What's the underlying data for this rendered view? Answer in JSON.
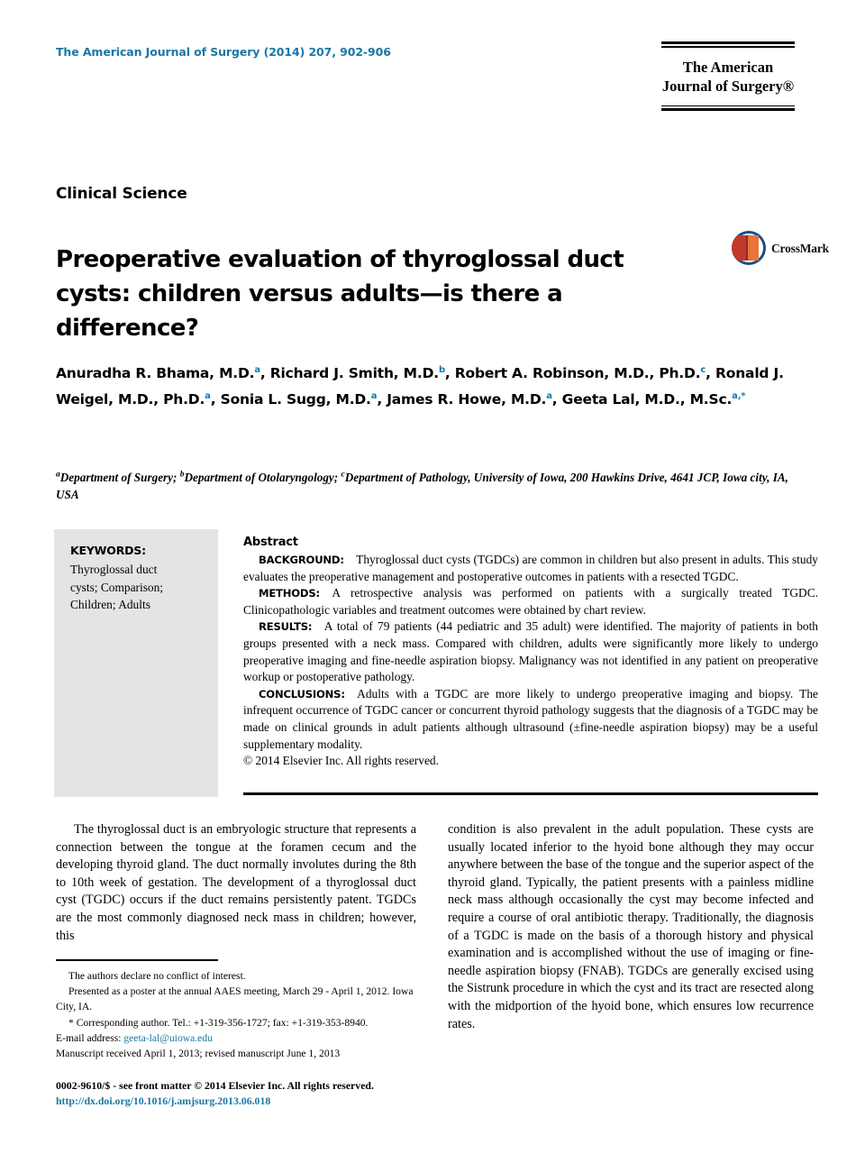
{
  "masthead": {
    "journal_reference": "The American Journal of Surgery (2014) 207, 902-906",
    "logo_line1": "The American",
    "logo_line2": "Journal of Surgery®"
  },
  "section_label": "Clinical Science",
  "title": "Preoperative evaluation of thyroglossal duct cysts: children versus adults—is there a difference?",
  "crossmark": {
    "label": "CrossMark"
  },
  "authors_html": "Anuradha R. Bhama, M.D.<sup>a</sup>, Richard J. Smith, M.D.<sup>b</sup>, Robert A. Robinson, M.D., Ph.D.<sup>c</sup>, Ronald J. Weigel, M.D., Ph.D.<sup>a</sup>, Sonia L. Sugg, M.D.<sup>a</sup>, James R. Howe, M.D.<sup>a</sup>, Geeta Lal, M.D., M.Sc.<sup>a,*</sup>",
  "affiliations_html": "<sup>a</sup>Department of Surgery; <sup>b</sup>Department of Otolaryngology; <sup>c</sup>Department of Pathology, University of Iowa, 200 Hawkins Drive, 4641 JCP, Iowa city, IA, USA",
  "keywords": {
    "heading": "KEYWORDS:",
    "list": "Thyroglossal duct cysts; Comparison; Children; Adults"
  },
  "abstract": {
    "heading": "Abstract",
    "sections": [
      {
        "label": "BACKGROUND:",
        "text": "Thyroglossal duct cysts (TGDCs) are common in children but also present in adults. This study evaluates the preoperative management and postoperative outcomes in patients with a resected TGDC."
      },
      {
        "label": "METHODS:",
        "text": "A retrospective analysis was performed on patients with a surgically treated TGDC. Clinicopathologic variables and treatment outcomes were obtained by chart review."
      },
      {
        "label": "RESULTS:",
        "text": "A total of 79 patients (44 pediatric and 35 adult) were identified. The majority of patients in both groups presented with a neck mass. Compared with children, adults were significantly more likely to undergo preoperative imaging and fine-needle aspiration biopsy. Malignancy was not identified in any patient on preoperative workup or postoperative pathology."
      },
      {
        "label": "CONCLUSIONS:",
        "text": "Adults with a TGDC are more likely to undergo preoperative imaging and biopsy. The infrequent occurrence of TGDC cancer or concurrent thyroid pathology suggests that the diagnosis of a TGDC may be made on clinical grounds in adult patients although ultrasound (±fine-needle aspiration biopsy) may be a useful supplementary modality."
      }
    ],
    "copyright": "© 2014 Elsevier Inc. All rights reserved."
  },
  "body": {
    "left_column": "The thyroglossal duct is an embryologic structure that represents a connection between the tongue at the foramen cecum and the developing thyroid gland. The duct normally involutes during the 8th to 10th week of gestation. The development of a thyroglossal duct cyst (TGDC) occurs if the duct remains persistently patent. TGDCs are the most commonly diagnosed neck mass in children; however, this",
    "right_column": "condition is also prevalent in the adult population. These cysts are usually located inferior to the hyoid bone although they may occur anywhere between the base of the tongue and the superior aspect of the thyroid gland. Typically, the patient presents with a painless midline neck mass although occasionally the cyst may become infected and require a course of oral antibiotic therapy. Traditionally, the diagnosis of a TGDC is made on the basis of a thorough history and physical examination and is accomplished without the use of imaging or fine-needle aspiration biopsy (FNAB). TGDCs are generally excised using the Sistrunk procedure in which the cyst and its tract are resected along with the midportion of the hyoid bone, which ensures low recurrence rates."
  },
  "footnotes": {
    "conflict": "The authors declare no conflict of interest.",
    "presented": "Presented as a poster at the annual AAES meeting, March 29 - April 1, 2012. Iowa City, IA.",
    "corresponding": "* Corresponding author. Tel.: +1-319-356-1727; fax: +1-319-353-8940.",
    "email_label": "E-mail address:",
    "email": "geeta-lal@uiowa.edu",
    "manuscript": "Manuscript received April 1, 2013; revised manuscript June 1, 2013"
  },
  "bottom": {
    "issn_line": "0002-9610/$ - see front matter © 2014 Elsevier Inc. All rights reserved.",
    "doi": "http://dx.doi.org/10.1016/j.amjsurg.2013.06.018"
  },
  "colors": {
    "accent_teal": "#1978a5",
    "keywords_bg": "#e4e4e4",
    "crossmark_blue": "#1a4d8f",
    "crossmark_red": "#c0392b"
  }
}
